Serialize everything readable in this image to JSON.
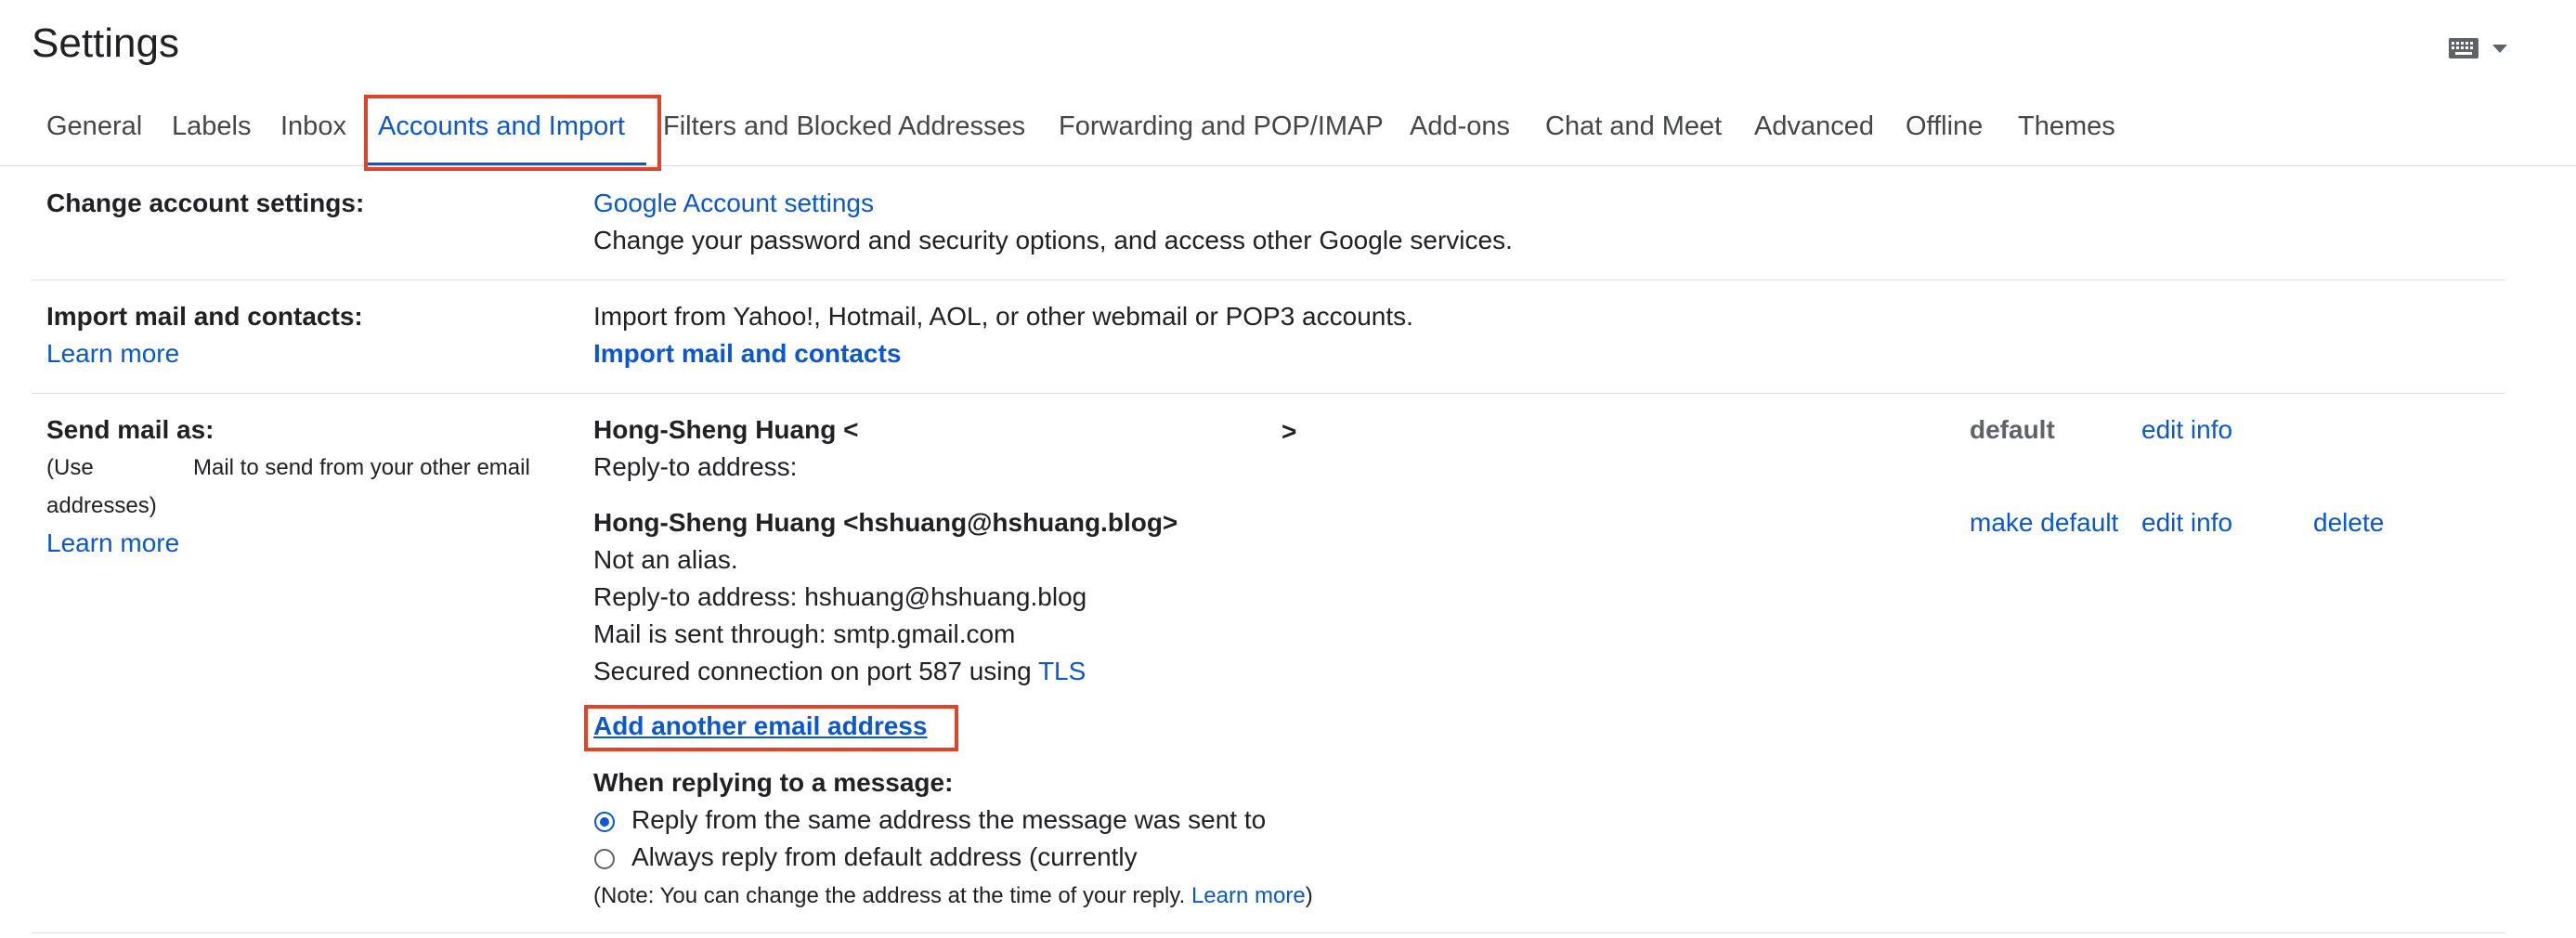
{
  "header": {
    "title": "Settings",
    "input_tools_icon": "keyboard-icon"
  },
  "tabs": [
    {
      "label": "General"
    },
    {
      "label": "Labels"
    },
    {
      "label": "Inbox"
    },
    {
      "label": "Accounts and Import",
      "active": true
    },
    {
      "label": "Filters and Blocked Addresses"
    },
    {
      "label": "Forwarding and POP/IMAP"
    },
    {
      "label": "Add-ons"
    },
    {
      "label": "Chat and Meet"
    },
    {
      "label": "Advanced"
    },
    {
      "label": "Offline"
    },
    {
      "label": "Themes"
    }
  ],
  "change_account": {
    "label": "Change account settings:",
    "link": "Google Account settings",
    "description": "Change your password and security options, and access other Google services."
  },
  "import_mail": {
    "label": "Import mail and contacts:",
    "learn_more": "Learn more",
    "description": "Import from Yahoo!, Hotmail, AOL, or other webmail or POP3 accounts.",
    "action": "Import mail and contacts"
  },
  "send_mail_as": {
    "label": "Send mail as:",
    "help_line1_a": "(Use",
    "help_line1_b": "Mail to send from your other email",
    "help_line2": "addresses)",
    "learn_more": "Learn more",
    "accounts": [
      {
        "name_open": "Hong-Sheng Huang <",
        "name_close": ">",
        "reply_to": "Reply-to address:",
        "status": "default",
        "edit": "edit info"
      },
      {
        "name": "Hong-Sheng Huang <hshuang@hshuang.blog>",
        "alias": "Not an alias.",
        "reply_to": "Reply-to address: hshuang@hshuang.blog",
        "sent_through": "Mail is sent through: smtp.gmail.com",
        "secured_prefix": "Secured connection on port 587 using",
        "secured_link": "TLS",
        "make_default": "make default",
        "edit": "edit info",
        "delete": "delete"
      }
    ],
    "add_address": "Add another email address",
    "replying_heading": "When replying to a message:",
    "reply_options": [
      {
        "label": "Reply from the same address the message was sent to",
        "selected": true
      },
      {
        "label": "Always reply from default address (currently",
        "selected": false
      }
    ],
    "note_prefix": "(Note: You can change the address at the time of your reply.",
    "note_link": "Learn more",
    "note_suffix": ")"
  },
  "colors": {
    "accent": "#0b57d0",
    "highlight": "#e0432a"
  }
}
